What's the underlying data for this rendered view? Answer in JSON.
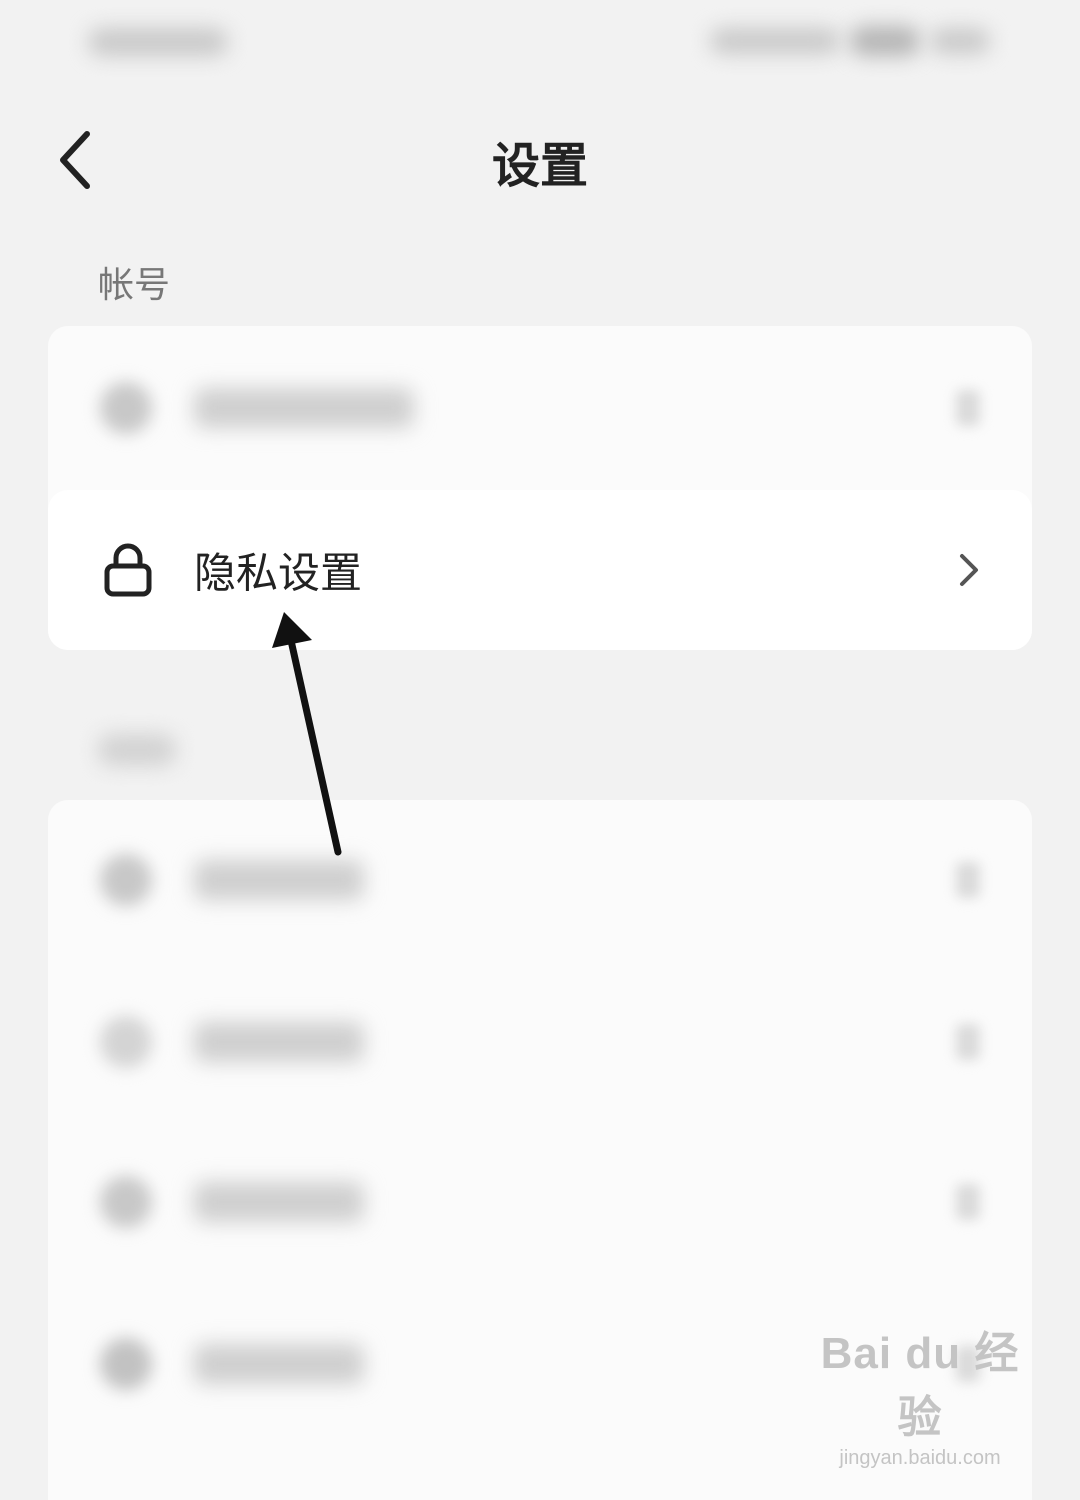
{
  "header": {
    "title": "设置",
    "back_icon": "chevron-left-icon"
  },
  "sections": [
    {
      "label": "帐号",
      "items": [
        {
          "label": "",
          "icon": "person-icon",
          "blurred": true
        },
        {
          "label": "隐私设置",
          "icon": "lock-icon",
          "blurred": false
        }
      ]
    },
    {
      "label": "",
      "items": [
        {
          "label": "",
          "blurred": true
        },
        {
          "label": "",
          "blurred": true
        },
        {
          "label": "",
          "blurred": true
        },
        {
          "label": "",
          "blurred": true
        }
      ]
    }
  ],
  "watermark": {
    "brand": "Bai du 经验",
    "url": "jingyan.baidu.com"
  }
}
